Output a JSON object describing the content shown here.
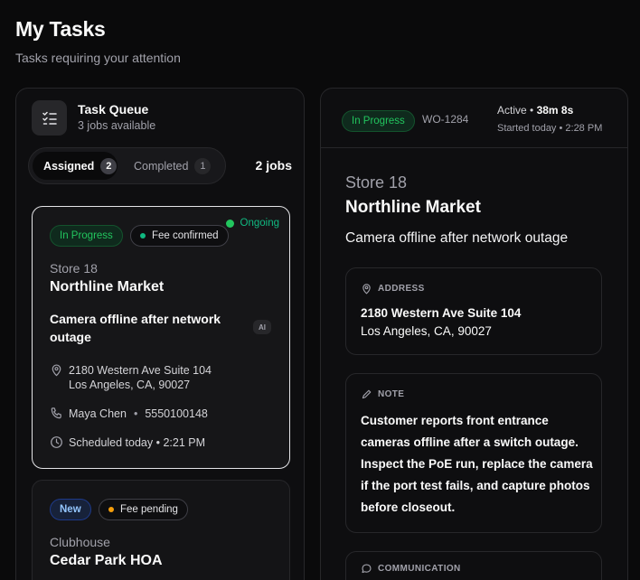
{
  "page": {
    "title": "My Tasks",
    "subtitle": "Tasks requiring your attention"
  },
  "queue": {
    "title": "Task Queue",
    "subtitle": "3 jobs available",
    "tabs": [
      {
        "label": "Assigned",
        "count": "2",
        "active": true
      },
      {
        "label": "Completed",
        "count": "1",
        "active": false
      }
    ],
    "jobs_count": "2 jobs"
  },
  "tasks": [
    {
      "status": "In Progress",
      "fee": "Fee confirmed",
      "live": "Ongoing",
      "store_no": "Store 18",
      "store_name": "Northline Market",
      "issue": "Camera offline after network outage",
      "ai_badge": "AI",
      "address_line1": "2180 Western Ave Suite 104",
      "address_line2": "Los Angeles, CA, 90027",
      "contact_name": "Maya Chen",
      "contact_phone": "5550100148",
      "scheduled": "Scheduled today • 2:21 PM"
    },
    {
      "status": "New",
      "fee": "Fee pending",
      "store_no": "Clubhouse",
      "store_name": "Cedar Park HOA"
    }
  ],
  "detail": {
    "status": "In Progress",
    "work_order": "WO-1284",
    "active_label": "Active •",
    "active_time": "38m 8s",
    "started": "Started today • 2:28 PM",
    "store_no": "Store 18",
    "store_name": "Northline Market",
    "issue": "Camera offline after network outage",
    "address": {
      "label": "ADDRESS",
      "line1": "2180 Western Ave Suite 104",
      "line2": "Los Angeles, CA, 90027"
    },
    "note": {
      "label": "NOTE",
      "text": "Customer reports front entrance cameras offline after a switch outage. Inspect the PoE run, replace the camera if the port test fails, and capture photos before closeout."
    },
    "communication": {
      "label": "COMMUNICATION"
    }
  },
  "colors": {
    "background": "#0a0a0b",
    "accent_green": "#22c55e",
    "accent_blue": "#93c5fd",
    "accent_orange": "#f59e0b"
  }
}
